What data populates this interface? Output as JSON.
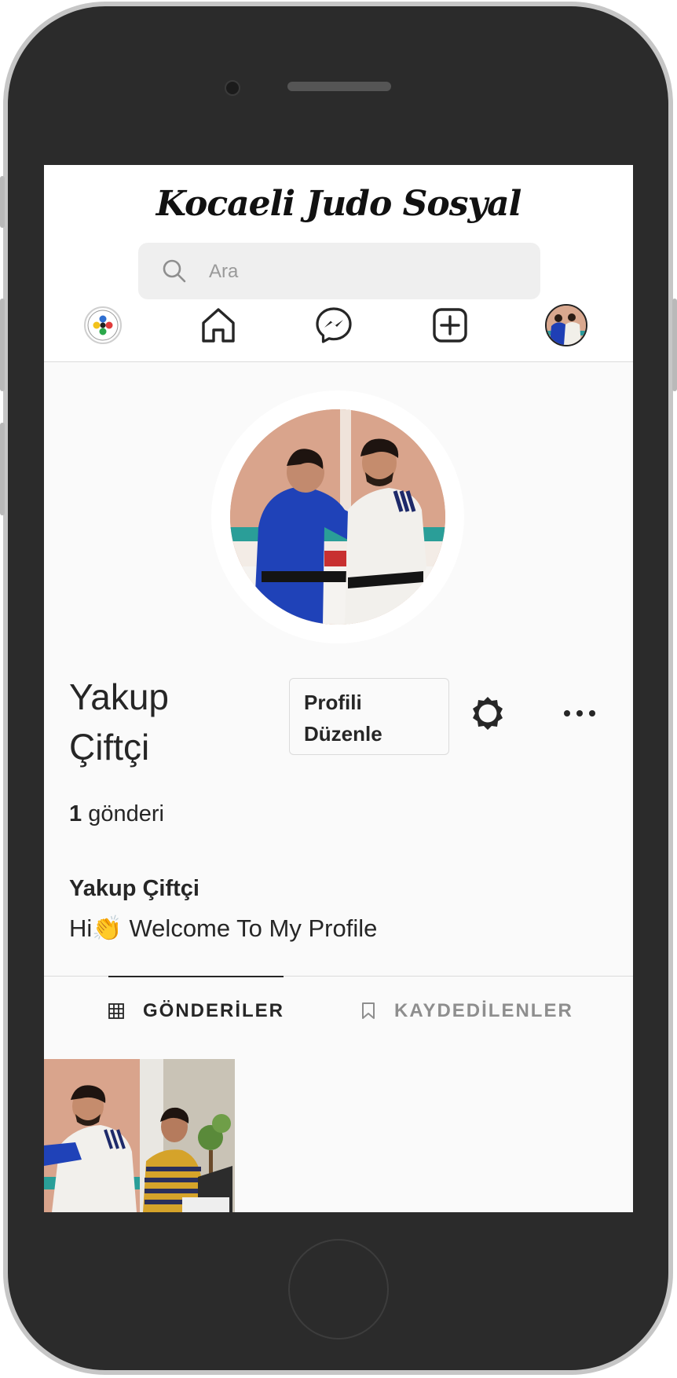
{
  "app": {
    "title": "Kocaeli Judo Sosyal"
  },
  "search": {
    "placeholder": "Ara"
  },
  "nav": {
    "items": [
      "ijf-logo-icon",
      "home-icon",
      "messenger-icon",
      "new-post-icon",
      "profile-avatar"
    ]
  },
  "profile": {
    "username": "Yakup Çiftçi",
    "edit_button": "Profili Düzenle",
    "post_count": "1",
    "post_label": "gönderi",
    "full_name": "Yakup Çiftçi",
    "bio": "Hi👏 Welcome To My Profile"
  },
  "tabs": {
    "posts": "GÖNDERİLER",
    "saved": "KAYDEDİLENLER"
  },
  "colors": {
    "screen_bg": "#fafafa",
    "text": "#262626",
    "muted": "#8e8e8e",
    "border": "#dbdbdb",
    "judogi_blue": "#1f3fb5"
  }
}
